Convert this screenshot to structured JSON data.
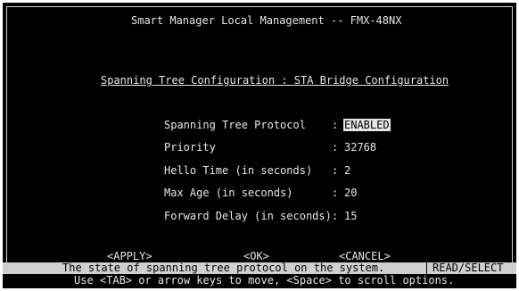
{
  "header": {
    "title": "Smart Manager Local Management -- FMX-48NX"
  },
  "page": {
    "subtitle": "Spanning Tree Configuration : STA Bridge Configuration"
  },
  "fields": [
    {
      "label": "Spanning Tree Protocol",
      "value": "ENABLED"
    },
    {
      "label": "Priority",
      "value": "32768"
    },
    {
      "label": "Hello Time (in seconds)",
      "value": "2"
    },
    {
      "label": "Max Age (in seconds)",
      "value": "20"
    },
    {
      "label": "Forward Delay (in seconds)",
      "value": "15"
    }
  ],
  "actions": {
    "apply": "<APPLY>",
    "ok": "<OK>",
    "cancel": "<CANCEL>"
  },
  "status": {
    "message": "The state of spanning tree protocol on the system.",
    "mode": "READ/SELECT"
  },
  "help": {
    "text": "Use <TAB> or arrow keys to move, <Space> to scroll options."
  },
  "colors": {
    "background": "#000000",
    "foreground": "#e6e6e6",
    "statusbar": "#cfcfcf"
  }
}
